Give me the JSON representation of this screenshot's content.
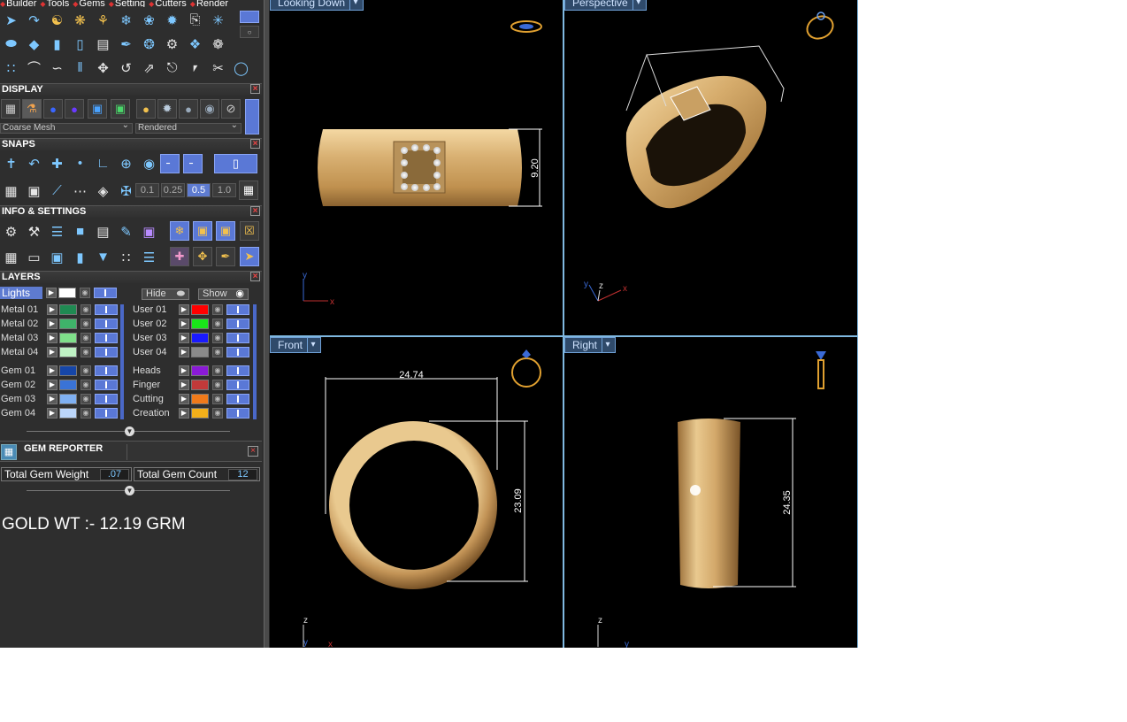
{
  "menu": [
    "Builder",
    "Tools",
    "Gems",
    "Setting",
    "Cutters",
    "Render"
  ],
  "display": {
    "title": "DISPLAY",
    "mesh_dropdown": "Coarse Mesh",
    "render_dropdown": "Rendered"
  },
  "snaps": {
    "title": "SNAPS",
    "values": [
      "0.1",
      "0.25",
      "0.5",
      "1.0"
    ],
    "active_value": "0.5"
  },
  "info": {
    "title": "INFO & SETTINGS"
  },
  "layers": {
    "title": "LAYERS",
    "lights_label": "Lights",
    "hide_label": "Hide",
    "show_label": "Show",
    "left": [
      {
        "name": "Metal 01",
        "color": "#1f8a52"
      },
      {
        "name": "Metal 02",
        "color": "#3fb36a"
      },
      {
        "name": "Metal 03",
        "color": "#7fe08a"
      },
      {
        "name": "Metal 04",
        "color": "#bff2c4"
      },
      {
        "name": "Gem 01",
        "color": "#1646a8"
      },
      {
        "name": "Gem 02",
        "color": "#3a73d6"
      },
      {
        "name": "Gem 03",
        "color": "#7fb0f2"
      },
      {
        "name": "Gem 04",
        "color": "#bcd6fa"
      }
    ],
    "right": [
      {
        "name": "User 01",
        "color": "#ff0000"
      },
      {
        "name": "User 02",
        "color": "#19e619"
      },
      {
        "name": "User 03",
        "color": "#1a1aff"
      },
      {
        "name": "User 04",
        "color": "#8a8a8a"
      },
      {
        "name": "Heads",
        "color": "#8a1ad6"
      },
      {
        "name": "Finger",
        "color": "#c23a3a"
      },
      {
        "name": "Cutting",
        "color": "#f07a1a"
      },
      {
        "name": "Creation",
        "color": "#f2b01a"
      }
    ]
  },
  "gem_reporter": {
    "title": "GEM REPORTER",
    "weight_label": "Total Gem Weight",
    "weight_value": ".07",
    "count_label": "Total Gem Count",
    "count_value": "12"
  },
  "gold_weight": "GOLD WT :- 12.19 GRM",
  "viewports": {
    "top_left": {
      "label": "Looking Down",
      "dim": "9.20"
    },
    "top_right": {
      "label": "Perspective"
    },
    "bottom_left": {
      "label": "Front",
      "width_dim": "24.74",
      "height_dim": "23.09"
    },
    "bottom_right": {
      "label": "Right",
      "height_dim": "24.35"
    }
  },
  "colors": {
    "gold": "#d4a460",
    "viewport_border": "#7fb8e0",
    "accent_blue": "#5a78d6"
  }
}
